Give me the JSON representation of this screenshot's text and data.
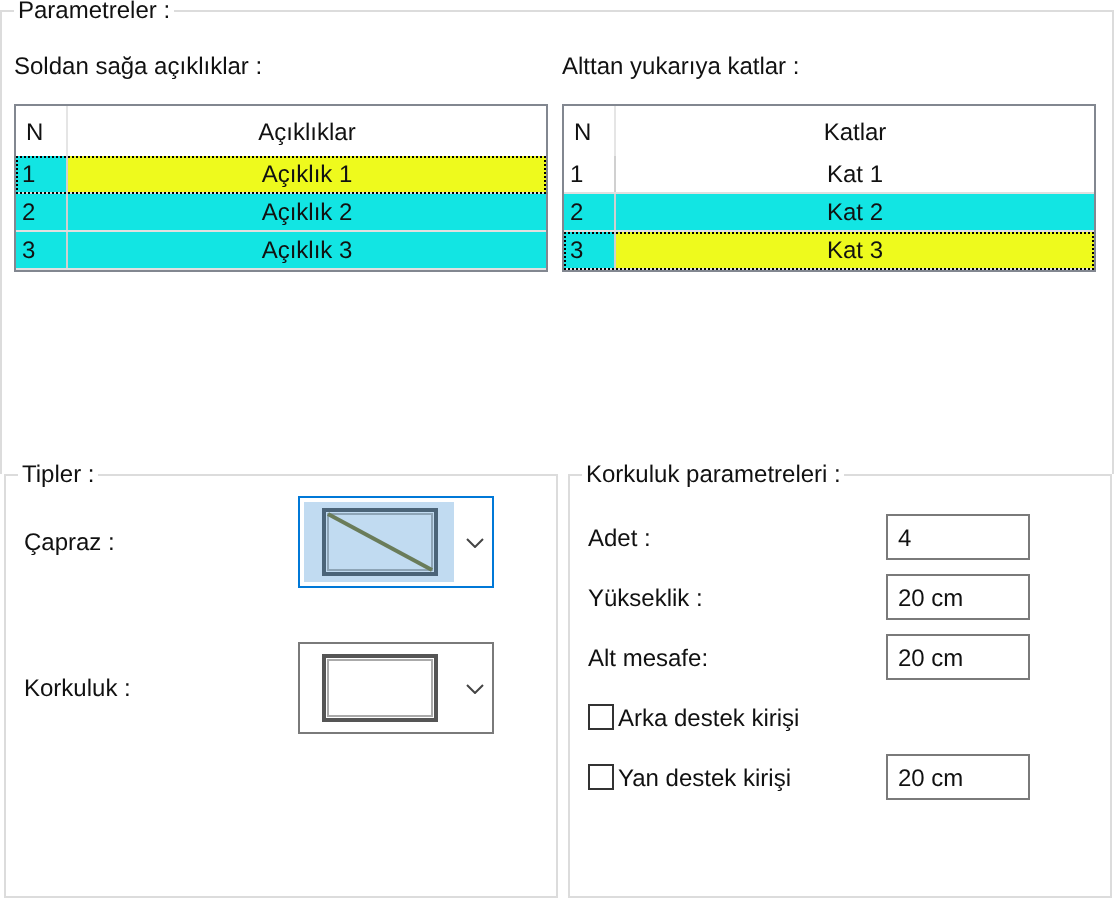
{
  "parameters": {
    "title": "Parametreler :",
    "spans": {
      "label": "Soldan sağa açıklıklar :",
      "columns": [
        "N",
        "Açıklıklar"
      ],
      "rows": [
        {
          "n": "1",
          "name": "Açıklık 1",
          "selected": true,
          "focused": true
        },
        {
          "n": "2",
          "name": "Açıklık 2",
          "selected": true,
          "focused": false
        },
        {
          "n": "3",
          "name": "Açıklık 3",
          "selected": true,
          "focused": false
        }
      ]
    },
    "floors": {
      "label": "Alttan yukarıya katlar :",
      "columns": [
        "N",
        "Katlar"
      ],
      "rows": [
        {
          "n": "1",
          "name": "Kat 1",
          "selected": false,
          "focused": false
        },
        {
          "n": "2",
          "name": "Kat 2",
          "selected": true,
          "focused": false
        },
        {
          "n": "3",
          "name": "Kat 3",
          "selected": true,
          "focused": true
        }
      ]
    }
  },
  "types": {
    "title": "Tipler :",
    "items": [
      {
        "label": "Çapraz :",
        "kind": "diagonal",
        "focused": true
      },
      {
        "label": "Korkuluk :",
        "kind": "plain",
        "focused": false
      }
    ]
  },
  "railing": {
    "title": "Korkuluk parametreleri :",
    "items": [
      {
        "kind": "field",
        "label": "Adet :",
        "value": "4"
      },
      {
        "kind": "field",
        "label": "Yükseklik :",
        "value": "20 cm"
      },
      {
        "kind": "field",
        "label": "Alt mesafe:",
        "value": "20 cm"
      },
      {
        "kind": "checkbox",
        "label": "Arka destek kirişi",
        "checked": false
      },
      {
        "kind": "checkbox",
        "label": "Yan destek kirişi",
        "checked": false,
        "value": "20 cm"
      }
    ]
  }
}
